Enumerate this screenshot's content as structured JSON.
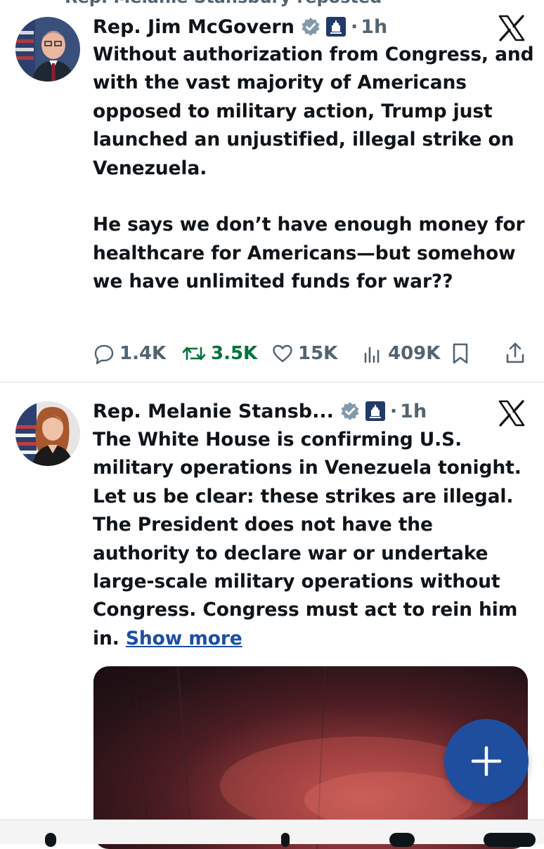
{
  "top_context": {
    "repost_label": "Rep. Melanie Stansbury reposted"
  },
  "tweets": [
    {
      "author_name": "Rep. Jim McGovern",
      "dot": "·",
      "time": "1h",
      "text": "Without authorization from Congress, and with the vast majority of Americans opposed to military action, Trump just launched an unjustified, illegal strike on Venezuela.\n\nHe says we don’t have enough money for healthcare for Americans—but somehow we have unlimited funds for war??",
      "replies": "1.4K",
      "reposts": "3.5K",
      "likes": "15K",
      "views": "409K"
    },
    {
      "author_name": "Rep. Melanie Stansb...",
      "dot": "·",
      "time": "1h",
      "text": "The White House is confirming U.S. military operations in Venezuela tonight. Let us be clear: these strikes are illegal. The President does not have the authority to declare war or undertake large-scale military operations without Congress. Congress must act to rein him in. ",
      "show_more": "Show more"
    }
  ],
  "colors": {
    "accent": "#1f4e9e",
    "muted": "#536471",
    "repost_green": "#00733b",
    "link": "#1d4fa3"
  },
  "icons": [
    "verified-badge-icon",
    "government-capitol-icon",
    "x-logo-icon",
    "reply-icon",
    "repost-icon",
    "like-icon",
    "views-icon",
    "bookmark-icon",
    "share-icon",
    "plus-icon"
  ]
}
